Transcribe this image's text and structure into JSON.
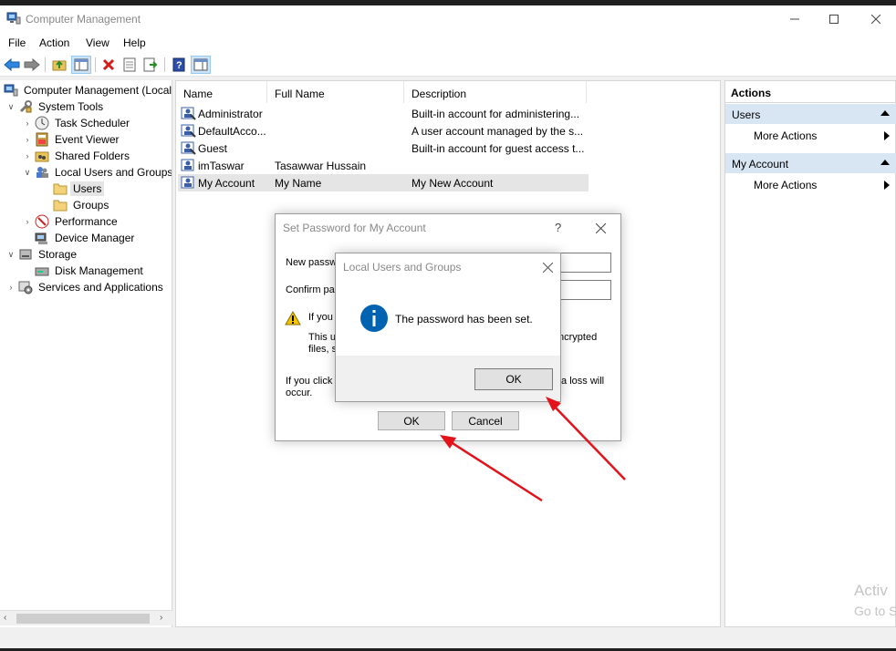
{
  "window": {
    "title": "Computer Management"
  },
  "menu": [
    "File",
    "Action",
    "View",
    "Help"
  ],
  "tree": {
    "root": "Computer Management (Local",
    "system_tools": "System Tools",
    "task_scheduler": "Task Scheduler",
    "event_viewer": "Event Viewer",
    "shared_folders": "Shared Folders",
    "local_users_groups": "Local Users and Groups",
    "users": "Users",
    "groups": "Groups",
    "performance": "Performance",
    "device_manager": "Device Manager",
    "storage": "Storage",
    "disk_management": "Disk Management",
    "services_apps": "Services and Applications"
  },
  "list": {
    "columns": [
      "Name",
      "Full Name",
      "Description"
    ],
    "rows": [
      {
        "name": "Administrator",
        "full_name": "",
        "description": "Built-in account for administering..."
      },
      {
        "name": "DefaultAcco...",
        "full_name": "",
        "description": "A user account managed by the s..."
      },
      {
        "name": "Guest",
        "full_name": "",
        "description": "Built-in account for guest access t..."
      },
      {
        "name": "imTaswar",
        "full_name": "Tasawwar Hussain",
        "description": ""
      },
      {
        "name": "My Account",
        "full_name": "My Name",
        "description": "My New Account"
      }
    ]
  },
  "actions": {
    "title": "Actions",
    "groups": [
      {
        "label": "Users",
        "item": "More Actions"
      },
      {
        "label": "My Account",
        "item": "More Actions"
      }
    ]
  },
  "set_password_dialog": {
    "title": "Set Password for My Account",
    "help": "?",
    "new_password_label": "New passw",
    "confirm_password_label": "Confirm pas",
    "warning_line": "If you c",
    "info_line1_left": "This us",
    "info_line1_right": "ncrypted",
    "info_line2_left": "files, st",
    "bottom_left": "If you click",
    "bottom_right": "ta loss will",
    "bottom_line2": "occur.",
    "ok": "OK",
    "cancel": "Cancel"
  },
  "message_box": {
    "title": "Local Users and Groups",
    "message": "The password has been set.",
    "ok": "OK"
  },
  "watermark": {
    "line1": "Activ",
    "line2": "Go to S"
  },
  "colors": {
    "selection": "#e5e5e5",
    "action_group": "#d8e6f4",
    "info_blue": "#0063b1",
    "arrow_red": "#e3121b"
  }
}
